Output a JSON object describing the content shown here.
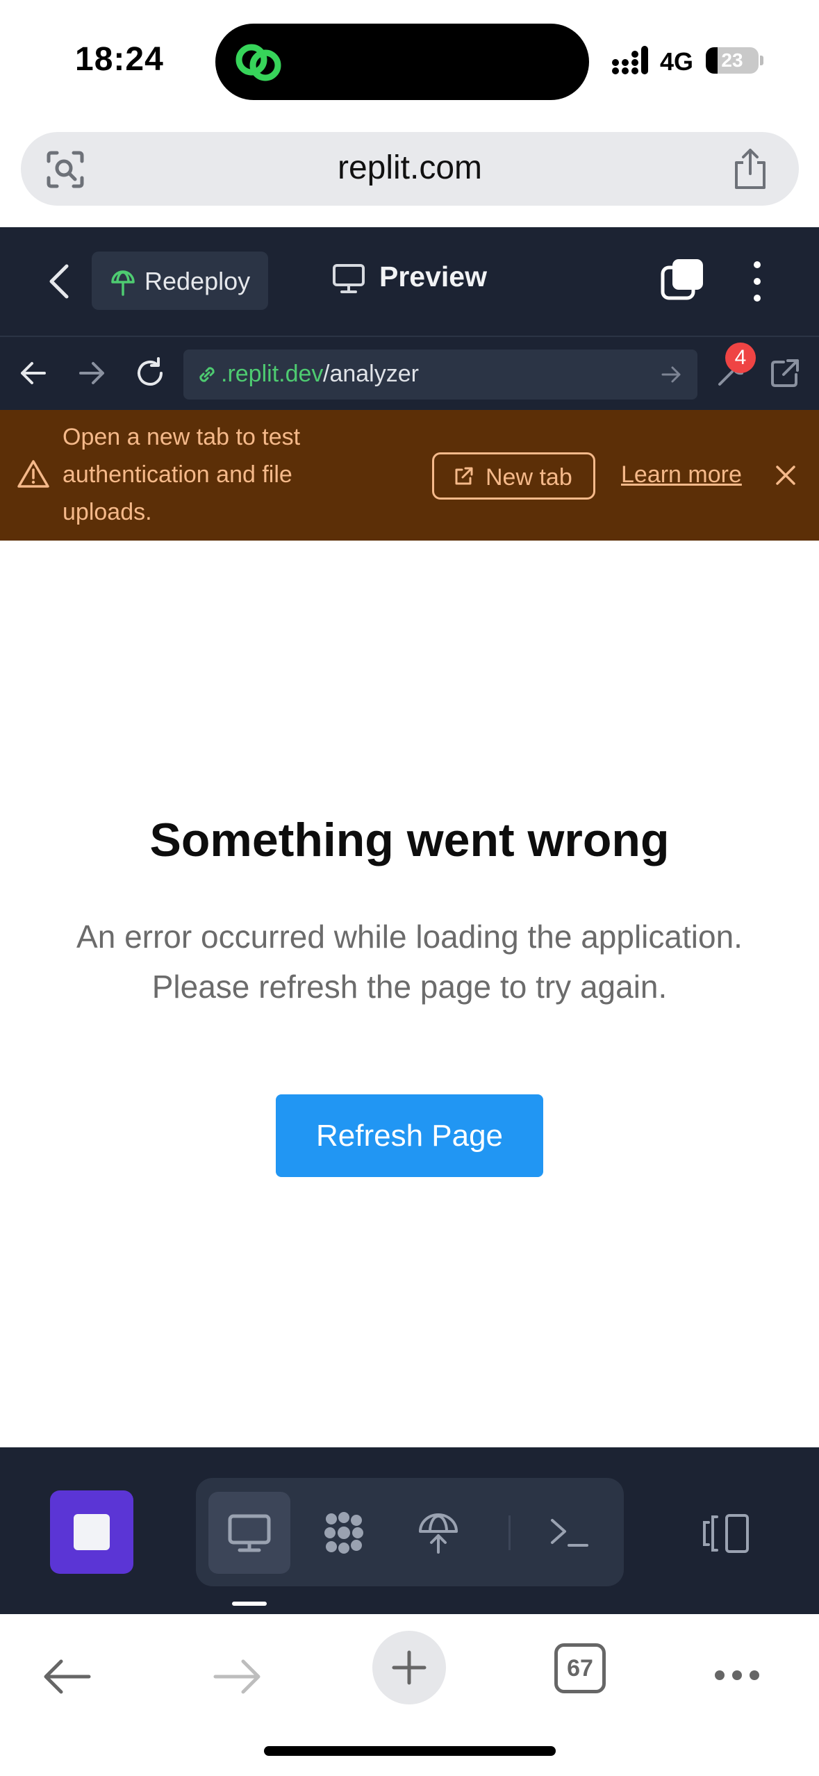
{
  "status_bar": {
    "time": "18:24",
    "network": "4G",
    "battery": "23",
    "battery_level": 0.23
  },
  "browser": {
    "domain": "replit.com",
    "tab_count": "67"
  },
  "replit_header": {
    "redeploy_label": "Redeploy",
    "preview_label": "Preview"
  },
  "webview_nav": {
    "url_host": ".replit.dev",
    "url_path": "/analyzer",
    "devtools_badge": "4"
  },
  "banner": {
    "message": "Open a new tab to test authentication and file uploads.",
    "new_tab_label": "New tab",
    "learn_more_label": "Learn more"
  },
  "error_page": {
    "title": "Something went wrong",
    "body": "An error occurred while loading the application. Please refresh the page to try again.",
    "refresh_label": "Refresh Page"
  },
  "colors": {
    "header_bg": "#1c2333",
    "banner_bg": "#5c2f07",
    "banner_text": "#f5b98a",
    "url_green": "#4ecb71",
    "primary_button": "#2196f3",
    "stop_button": "#5b35d5",
    "badge_red": "#ef4444"
  },
  "icons": {
    "app": "replit-connection-icon",
    "lens": "screen-search-icon",
    "share": "share-icon",
    "tools": [
      "preview-icon",
      "workspace-icon",
      "deploy-icon",
      "shell-icon"
    ]
  }
}
